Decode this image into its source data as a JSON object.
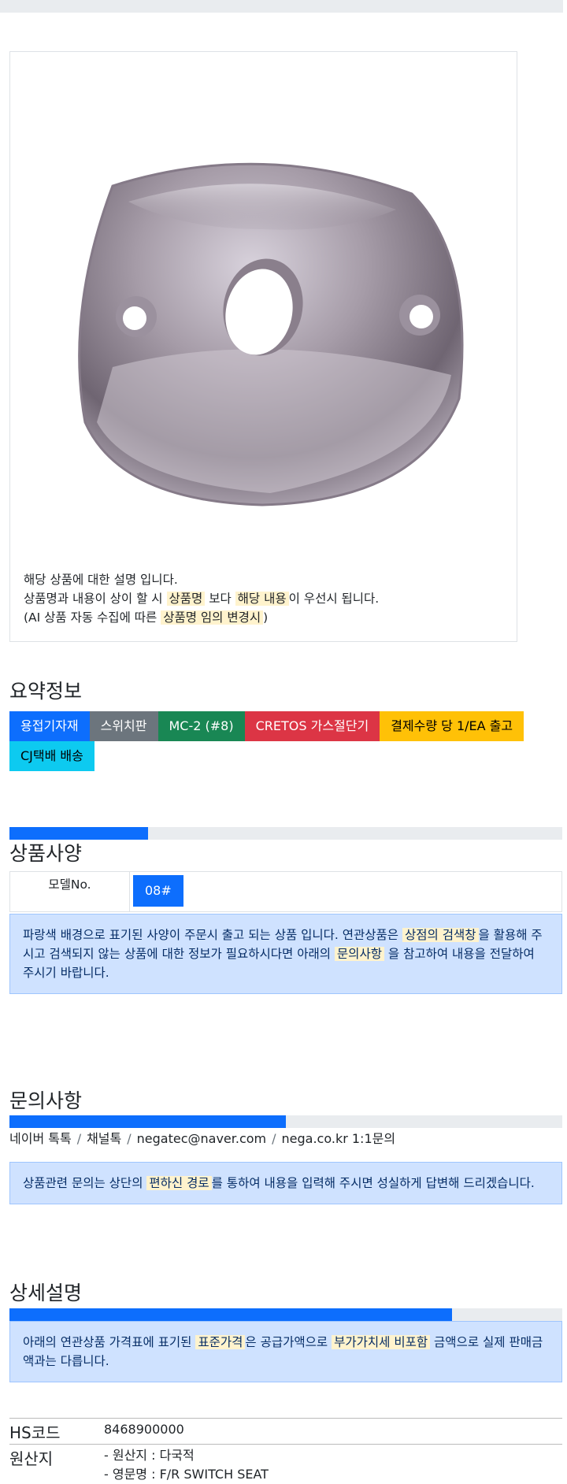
{
  "description": {
    "line1": "해당 상품에 대한 설명 입니다.",
    "line2_pre": "상품명과 내용이 상이 할 시 ",
    "line2_hl1": "상품명",
    "line2_mid": " 보다 ",
    "line2_hl2": "해당 내용",
    "line2_post": "이 우선시 됩니다.",
    "line3_pre": "(AI 상품 자동 수집에 따른 ",
    "line3_hl": "상품명 임의 변경시",
    "line3_post": ")"
  },
  "summary": {
    "title": "요약정보",
    "badges": [
      {
        "label": "용접기자재",
        "color": "#0d6efd",
        "text_color": "#ffffff"
      },
      {
        "label": "스위치판",
        "color": "#6c757d",
        "text_color": "#ffffff"
      },
      {
        "label": "MC-2 (#8)",
        "color": "#198754",
        "text_color": "#ffffff"
      },
      {
        "label": "CRETOS 가스절단기",
        "color": "#dc3545",
        "text_color": "#ffffff"
      },
      {
        "label": "결제수량 당 1/EA 출고",
        "color": "#ffc107",
        "text_color": "#000000"
      },
      {
        "label": "CJ택배 배송",
        "color": "#0dcaf0",
        "text_color": "#000000"
      }
    ]
  },
  "spec": {
    "title": "상품사양",
    "progress": 0.25,
    "model_label": "모델No.",
    "model_value": "08#",
    "notice_pre": "파랑색 배경으로 표기된 사양이 주문시 출고 되는 상품 입니다. 연관상품은 ",
    "notice_hl1": "상점의 검색창",
    "notice_mid": "을 활용해 주시고 검색되지 않는 상품에 대한 정보가 필요하시다면 아래의 ",
    "notice_hl2": "문의사항",
    "notice_post": " 을 참고하여 내용을 전달하여 주시기 바랍니다."
  },
  "inquiry": {
    "title": "문의사항",
    "progress": 0.5,
    "links": [
      "네이버 톡톡",
      "채널톡",
      "negatec@naver.com",
      "nega.co.kr 1:1문의"
    ],
    "separator": "/",
    "notice_pre": "상품관련 문의는 상단의 ",
    "notice_hl": "편하신 경로",
    "notice_post": "를 통하여 내용을 입력해 주시면 성실하게 답변해 드리겠습니다."
  },
  "detail": {
    "title": "상세설명",
    "progress": 0.8,
    "notice_pre": "아래의 연관상품 가격표에 표기된 ",
    "notice_hl1": "표준가격",
    "notice_mid": "은 공급가액으로 ",
    "notice_hl2": "부가가치세 비포함",
    "notice_post": " 금액으로 실제 판매금액과는 다릅니다."
  },
  "info": {
    "hs_label": "HS코드",
    "hs_value": "8468900000",
    "origin_label": "원산지",
    "origin_line1": "- 원산지 : 다국적",
    "origin_line2": "- 영문명 : F/R SWITCH SEAT"
  }
}
